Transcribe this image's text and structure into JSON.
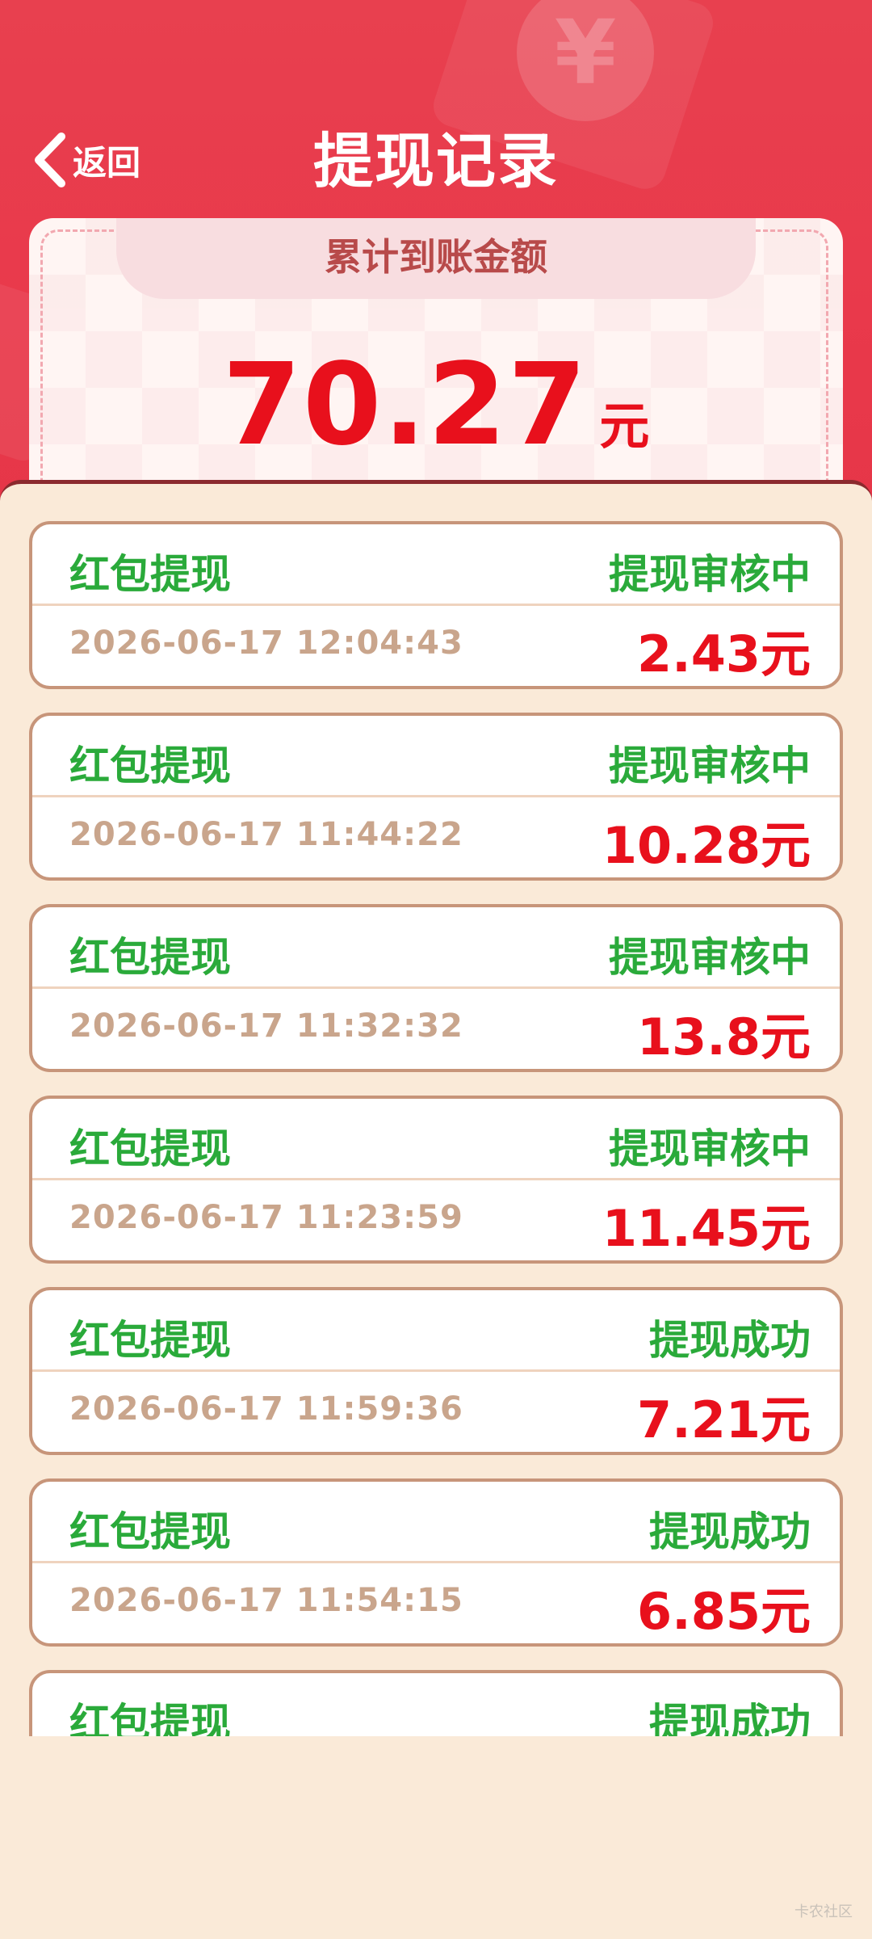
{
  "header": {
    "back_label": "返回",
    "title": "提现记录",
    "bg_color": "#E9394B"
  },
  "summary": {
    "label": "累计到账金额",
    "amount": "70.27",
    "unit": "元"
  },
  "records": [
    {
      "type": "红包提现",
      "status": "提现审核中",
      "time": "2026-06-17 12:04:43",
      "amount": "2.43元"
    },
    {
      "type": "红包提现",
      "status": "提现审核中",
      "time": "2026-06-17 11:44:22",
      "amount": "10.28元"
    },
    {
      "type": "红包提现",
      "status": "提现审核中",
      "time": "2026-06-17 11:32:32",
      "amount": "13.8元"
    },
    {
      "type": "红包提现",
      "status": "提现审核中",
      "time": "2026-06-17 11:23:59",
      "amount": "11.45元"
    },
    {
      "type": "红包提现",
      "status": "提现成功",
      "time": "2026-06-17 11:59:36",
      "amount": "7.21元"
    },
    {
      "type": "红包提现",
      "status": "提现成功",
      "time": "2026-06-17 11:54:15",
      "amount": "6.85元"
    },
    {
      "type": "红包提现",
      "status": "提现成功"
    }
  ],
  "colors": {
    "status_green": "#2AAA3A",
    "amount_red": "#E8101C",
    "time_tan": "#C9A58C",
    "panel_bg": "#FAEAD8"
  },
  "icons": {
    "back": "chevron-left-icon",
    "decoration": "yen-coin-icon"
  },
  "watermark": "卡农社区"
}
